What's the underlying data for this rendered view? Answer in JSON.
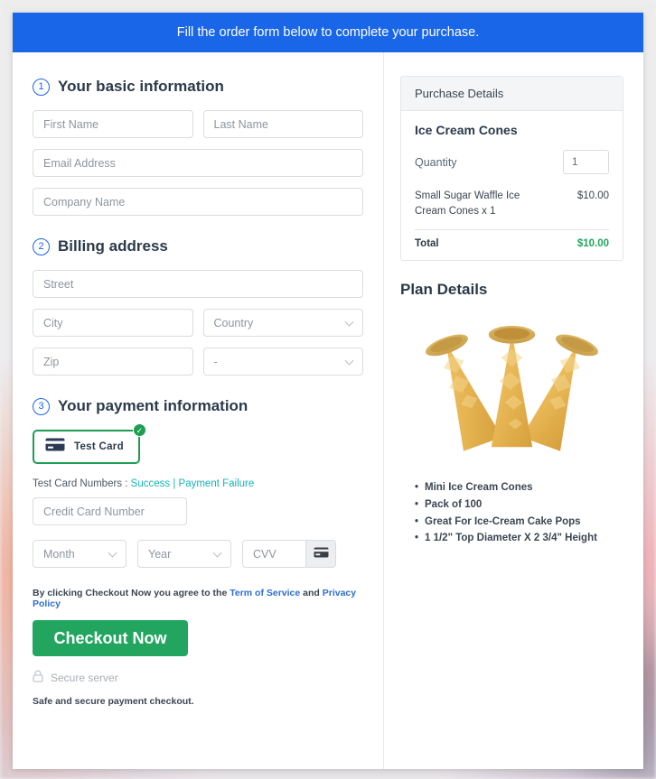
{
  "banner": {
    "text": "Fill the order form below to complete your purchase."
  },
  "colors": {
    "banner_blue": "#1a66e8",
    "accent_green": "#22a65f",
    "tile_green": "#1f9d55",
    "link_teal": "#15b3b8",
    "link_blue": "#2f6fd0",
    "total_green": "#22a65f"
  },
  "steps": [
    {
      "num": "1",
      "title": "Your basic information"
    },
    {
      "num": "2",
      "title": "Billing address"
    },
    {
      "num": "3",
      "title": "Your payment information"
    }
  ],
  "basic_info": {
    "first_name_placeholder": "First Name",
    "last_name_placeholder": "Last Name",
    "email_placeholder": "Email Address",
    "company_placeholder": "Company Name"
  },
  "billing": {
    "street_placeholder": "Street",
    "city_placeholder": "City",
    "country_placeholder": "Country",
    "zip_placeholder": "Zip",
    "state_placeholder": "-"
  },
  "payment": {
    "tile_label": "Test Card",
    "tile_badge": "✓",
    "card_icon": "credit-card-icon",
    "test_numbers_label": "Test Card Numbers :",
    "test_success_link": "Success",
    "test_separator": "|",
    "test_failure_link": "Payment Failure",
    "card_number_placeholder": "Credit Card Number",
    "month_placeholder": "Month",
    "year_placeholder": "Year",
    "cvv_placeholder": "CVV",
    "cvv_icon": "credit-card-icon"
  },
  "footer": {
    "terms_prefix": "By clicking Checkout Now you agree to the",
    "terms_link": "Term of Service",
    "terms_and": "and",
    "privacy_link": "Privacy Policy",
    "checkout_label": "Checkout Now",
    "secure_server": "Secure server",
    "secure_icon": "lock-icon",
    "safe_note": "Safe and secure payment checkout."
  },
  "purchase_details": {
    "header": "Purchase Details",
    "product_title": "Ice Cream Cones",
    "quantity_label": "Quantity",
    "quantity_value": "1",
    "line_item_desc": "Small Sugar Waffle Ice Cream Cones x 1",
    "line_item_amount": "$10.00",
    "total_label": "Total",
    "total_amount": "$10.00"
  },
  "plan_details": {
    "title": "Plan Details",
    "image_alt": "ice-cream-cones-photo",
    "bullets": [
      "Mini Ice Cream Cones",
      "Pack of 100",
      "Great For Ice-Cream Cake Pops",
      "1 1/2\" Top Diameter X 2 3/4\" Height"
    ]
  }
}
